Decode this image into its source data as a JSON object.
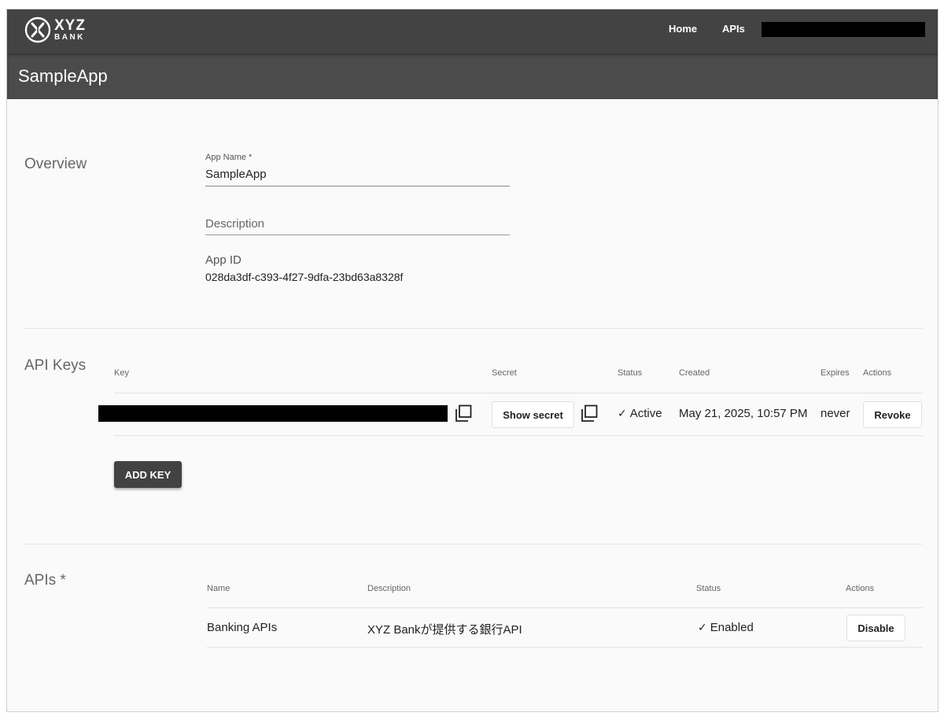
{
  "nav": {
    "logo_line1": "XYZ",
    "logo_line2": "BANK",
    "home": "Home",
    "apis": "APIs"
  },
  "header": {
    "title": "SampleApp"
  },
  "overview": {
    "title": "Overview",
    "app_name_label": "App Name *",
    "app_name_value": "SampleApp",
    "description_placeholder": "Description",
    "app_id_label": "App ID",
    "app_id_value": "028da3df-c393-4f27-9dfa-23bd63a8328f"
  },
  "api_keys": {
    "title": "API Keys",
    "columns": {
      "key": "Key",
      "secret": "Secret",
      "status": "Status",
      "created": "Created",
      "expires": "Expires",
      "actions": "Actions"
    },
    "rows": [
      {
        "secret_button": "Show secret",
        "status_icon": "✓",
        "status": "Active",
        "created": "May 21, 2025, 10:57 PM",
        "expires": "never",
        "action": "Revoke"
      }
    ],
    "add_button": "ADD KEY"
  },
  "apis": {
    "title": "APIs *",
    "columns": {
      "name": "Name",
      "description": "Description",
      "status": "Status",
      "actions": "Actions"
    },
    "rows": [
      {
        "name": "Banking APIs",
        "description": "XYZ Bankが提供する銀行API",
        "status_icon": "✓",
        "status": "Enabled",
        "action": "Disable"
      }
    ]
  },
  "icons": {
    "logo": "xyz-bank-logo-icon",
    "copy": "copy-icon",
    "check": "check-icon"
  },
  "colors": {
    "topbar": "#434343",
    "appbar": "#4b4b4b",
    "content_bg": "#fafafa",
    "primary_button": "#424242"
  }
}
